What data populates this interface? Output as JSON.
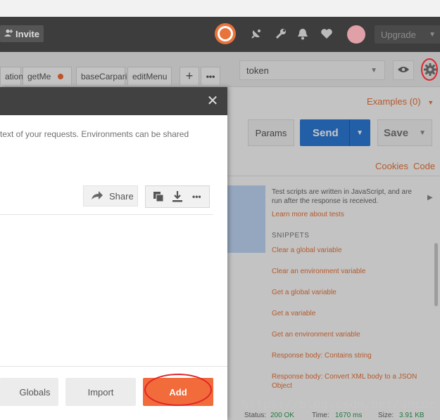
{
  "header": {
    "invite_label": "Invite",
    "upgrade_label": "Upgrade"
  },
  "tabs": [
    {
      "label": "ation"
    },
    {
      "label": "getMe"
    },
    {
      "label": "baseCarpari"
    },
    {
      "label": "editMenu"
    }
  ],
  "environment": {
    "selected": "token"
  },
  "request": {
    "examples_label": "Examples (0)",
    "params_label": "Params",
    "send_label": "Send",
    "save_label": "Save",
    "cookies_label": "Cookies",
    "code_label": "Code"
  },
  "tests_panel": {
    "info": "Test scripts are written in JavaScript, and are run after the response is received.",
    "learn_more": "Learn more about tests",
    "snippets_heading": "SNIPPETS",
    "snippets": [
      "Clear a global variable",
      "Clear an environment variable",
      "Get a global variable",
      "Get a variable",
      "Get an environment variable",
      "Response body: Contains string",
      "Response body: Convert XML body to a JSON Object"
    ]
  },
  "status": {
    "status_label": "Status:",
    "status_value": "200 OK",
    "time_label": "Time:",
    "time_value": "1670 ms",
    "size_label": "Size:",
    "size_value": "3.91 KB"
  },
  "modal": {
    "description": "text of your requests. Environments can be shared",
    "share_label": "Share",
    "globals_label": "Globals",
    "import_label": "Import",
    "add_label": "Add"
  },
  "watermark": "https://blog.csdn.net/ancdc",
  "colors": {
    "accent": "#f26b3a",
    "send_blue": "#2e7ad6",
    "header_dark": "#3d3d3d",
    "highlight_ring": "#e0242c"
  }
}
